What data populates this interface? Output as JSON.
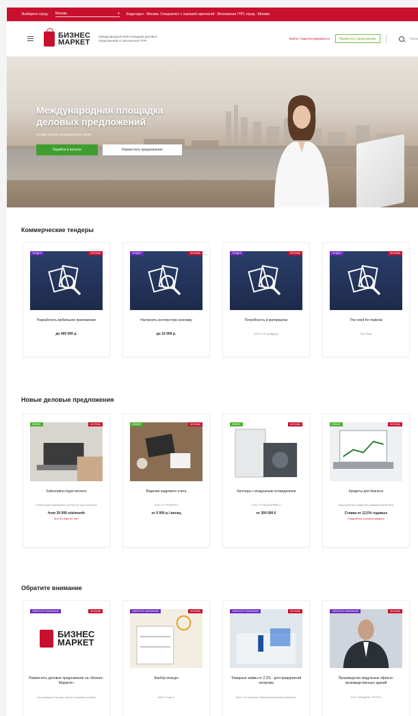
{
  "topbar": {
    "city_label": "Выберите город:",
    "city_value": "Москва",
    "news": "Еждегодно - Москва. Специалист с хорошей зарплатой - Московская ТПП, город - Москва"
  },
  "header": {
    "logo_line1": "БИЗНЕС",
    "logo_line2": "МАРКЕТ",
    "tagline": "Международная B2B-площадка деловых предложений от Московской ТПП",
    "link": "Войти / Зарегистрироваться",
    "button": "Разместить предложение",
    "search": "Поиск"
  },
  "hero": {
    "title": "Международная площадка деловых предложений",
    "subtitle": "на базе торгово-промышленных палат",
    "btn_catalog": "Перейти в каталог",
    "btn_offer": "Разместить предложение"
  },
  "sections": {
    "tenders": {
      "title": "Коммерческие тендеры",
      "items": [
        {
          "tag": "ТЕНДЕР",
          "city": "МОСКВА",
          "title": "Разработать мобильное приложение",
          "meta": "",
          "price": "до 400 000 р.",
          "note": ""
        },
        {
          "tag": "ТЕНДЕР",
          "city": "МОСКВА",
          "title": "Настроить контекстную рекламу",
          "meta": "",
          "price": "до 10 000 р.",
          "note": ""
        },
        {
          "tag": "ТЕНДЕР",
          "city": "МОСКВА",
          "title": "Потребность в материалах",
          "meta": "ООО «ГК-Трейдер»",
          "price": "",
          "note": ""
        },
        {
          "tag": "ТЕНДЕР",
          "city": "МОСКВА",
          "title": "The need for material",
          "meta": "Tanr Sofir",
          "price": "",
          "note": ""
        }
      ]
    },
    "offers": {
      "title": "Новые деловые предложения",
      "items": [
        {
          "tag": "НОВОЕ",
          "city": "МОСКВА",
          "title": "Subscription legal services",
          "meta": "Online legal subscription service for your business",
          "price": "from 30 000 rub/month",
          "note": "first 30 days for free"
        },
        {
          "tag": "НОВОЕ",
          "city": "МОСКВА",
          "title": "Ведение кадрового учета",
          "meta": "ООО «СТИЛМОН»",
          "price": "от 5 000 р./ месяц",
          "note": ""
        },
        {
          "tag": "НОВОЕ",
          "city": "МОСКВА",
          "title": "Чиллеры с воздушным охлаждением",
          "meta": "ООО «СПЕЦСЕРВИС»",
          "price": "от 300 000 €",
          "note": ""
        },
        {
          "tag": "НОВОЕ",
          "city": "МОСКВА",
          "title": "Кредиты для бизнеса",
          "meta": "Акционерное общество коммерческий банк",
          "price": "Ставка от 12,5% годовых",
          "note": "Подробные условия кредита"
        }
      ]
    },
    "attention": {
      "title": "Обратите внимание",
      "items": [
        {
          "tag": "ОБРАТИТЕ ВНИМАНИЕ",
          "city": "МОСКВА",
          "title": "Разместить деловое предложение на «Бизнес-Маркете»",
          "meta": "Ассоциация торговых палат в режиме онлайн",
          "price": "",
          "note": ""
        },
        {
          "tag": "ОБРАТИТЕ ВНИМАНИЕ",
          "city": "МОСКВА",
          "title": "StartUp конкурс",
          "meta": "НКО «Старт»",
          "price": "",
          "note": ""
        },
        {
          "tag": "ОБРАТИТЕ ВНИМАНИЕ",
          "city": "МОСКВА",
          "title": "Товарные займы от 2,2% - для предприятий легпрома",
          "meta": "АНО «Столичный Образовательный Комплекс»",
          "price": "",
          "note": ""
        },
        {
          "tag": "ОБРАТИТЕ ВНИМАНИЕ",
          "city": "МОСКВА",
          "title": "Производство модульных офисно-производственных зданий",
          "meta": "ООО «МОДУЛЬ ГРУПП»",
          "price": "",
          "note": ""
        }
      ]
    }
  },
  "colors": {
    "brand_red": "#c8102e",
    "green": "#3f9e2f",
    "purple": "#6a2bbf"
  }
}
